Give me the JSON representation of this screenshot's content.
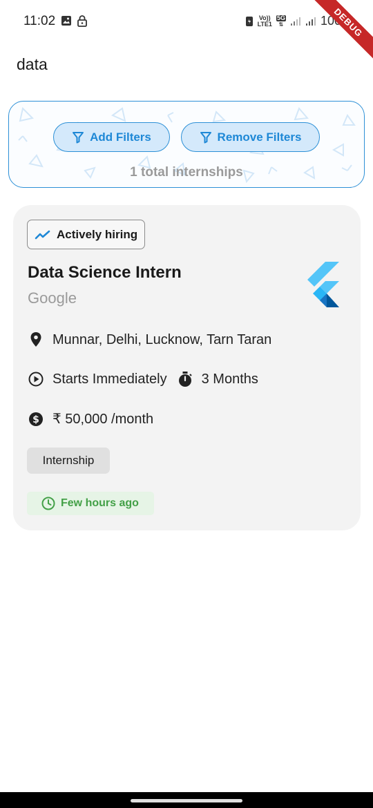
{
  "status_bar": {
    "time": "11:02",
    "network_top": "Vo))",
    "network_bottom": "LTE1",
    "network_5g": "5G",
    "battery": "100%",
    "debug_label": "DEBUG"
  },
  "app_bar": {
    "title": "data"
  },
  "filters": {
    "add_label": "Add Filters",
    "remove_label": "Remove Filters",
    "total_text": "1 total internships"
  },
  "listing": {
    "badge": "Actively hiring",
    "title": "Data Science Intern",
    "company": "Google",
    "location": "Munnar, Delhi, Lucknow, Tarn Taran",
    "start": "Starts Immediately",
    "duration": "3 Months",
    "stipend": "₹ 50,000 /month",
    "type": "Internship",
    "posted": "Few hours ago"
  },
  "colors": {
    "accent": "#2b8fd6",
    "accent_fill": "#d4e9fb",
    "card_bg": "#f3f3f3",
    "posted_green": "#43a047",
    "debug_red": "#c62828"
  },
  "icons": {
    "filter": "filter-icon",
    "trend": "trending-up-icon",
    "location": "location-pin-icon",
    "start": "play-circle-icon",
    "duration": "timer-icon",
    "stipend": "dollar-circle-icon",
    "posted": "clock-icon",
    "logo": "flutter-logo-icon"
  }
}
